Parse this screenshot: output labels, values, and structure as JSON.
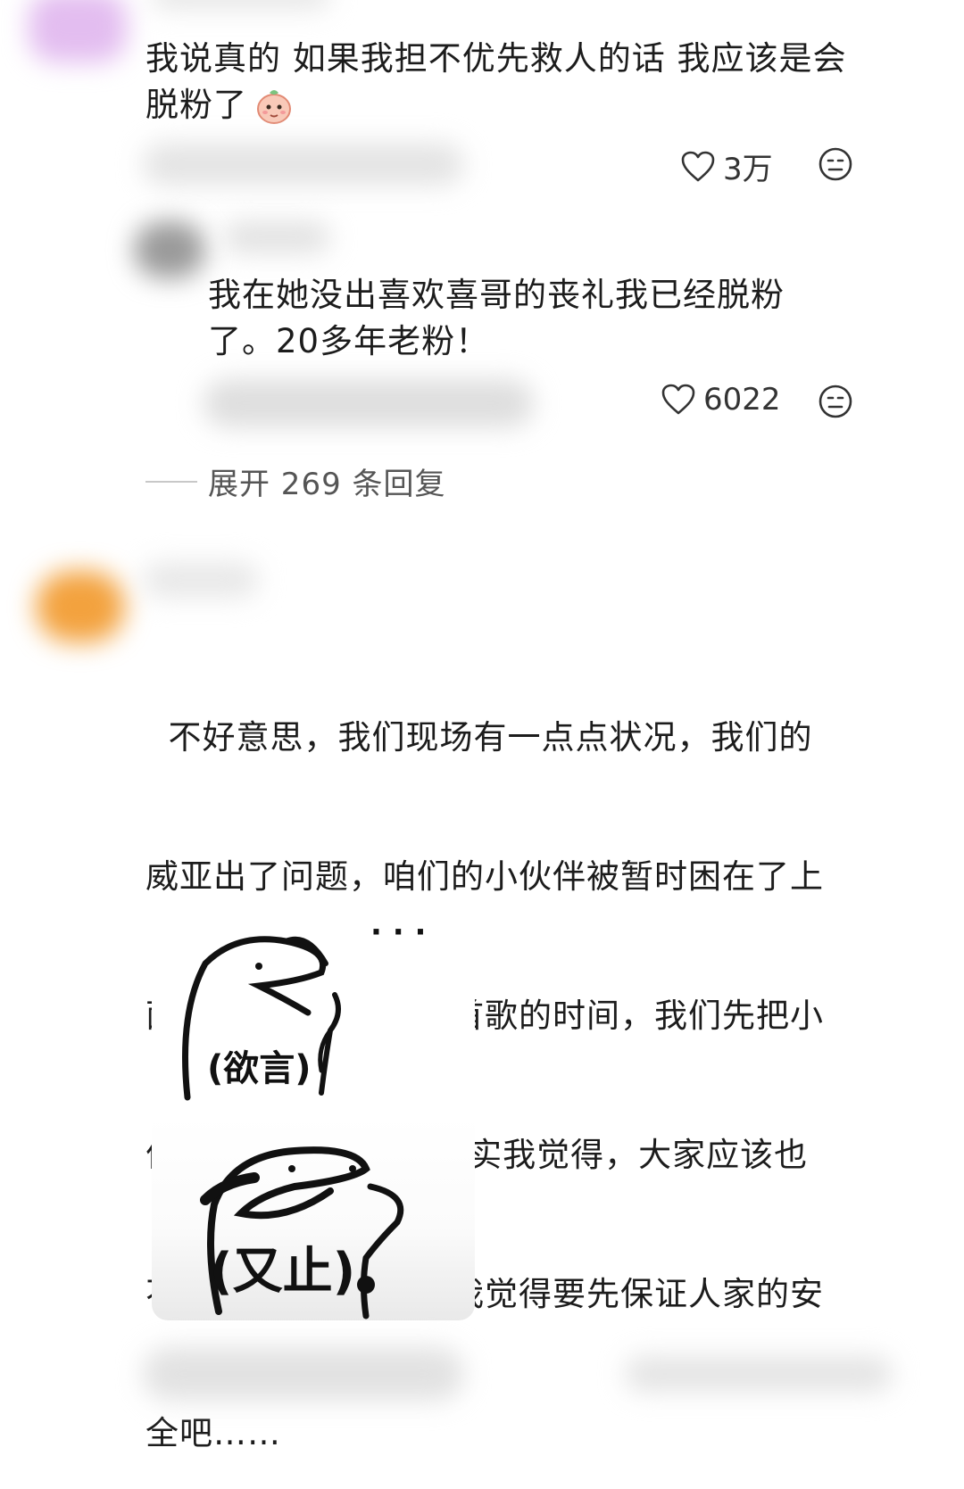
{
  "comments": [
    {
      "text_lines": [
        "我说真的 如果我担不优先救人的话 我应该是会",
        "脱粉了"
      ],
      "emoji": "baby-face-emoji",
      "likes": "3万"
    },
    {
      "text_lines": [
        "我在她没出喜欢喜哥的丧礼我已经脱粉",
        "了。20多年老粉！"
      ],
      "likes": "6022"
    }
  ],
  "expand": {
    "label": "展开 269 条回复"
  },
  "comment3": {
    "text_lines": [
      "  不好意思，我们现场有一点点状况，我们的",
      "威亚出了问题，咱们的小伙伴被暂时困在了上",
      "面，我们暂时暂停一首歌的时间，我们先把小",
      "伙伴接下来可以吗”其实我觉得，大家应该也",
      "不会有异议吧，起码我觉得要先保证人家的安",
      "全吧……"
    ]
  },
  "stickers": [
    {
      "caption": "(欲言)",
      "dots": "· · ·"
    },
    {
      "caption": "(又止)"
    }
  ],
  "colors": {
    "avatar1": "#e0b8f0",
    "avatar3": "#f5a040",
    "icon_stroke": "#333333"
  },
  "icons": {
    "like": "heart-outline-icon",
    "react": "neutral-face-icon"
  }
}
